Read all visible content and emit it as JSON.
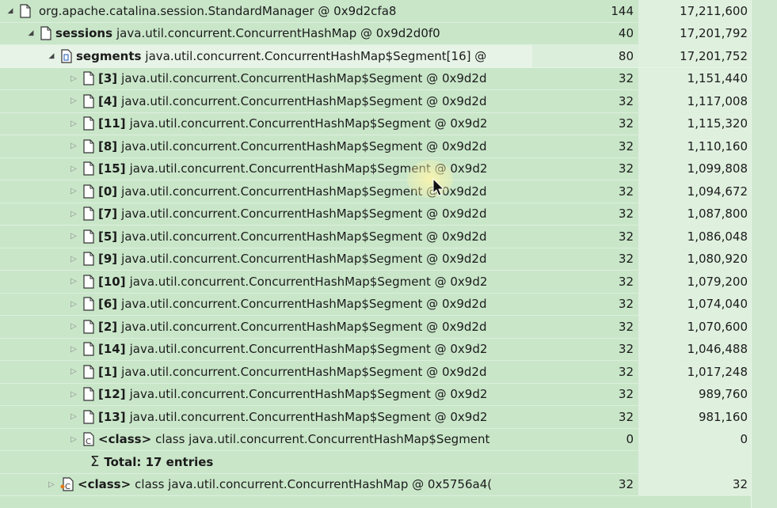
{
  "tree": {
    "rows": [
      {
        "field": "",
        "text": "org.apache.catalina.session.StandardManager @ 0x9d2cfa8",
        "shallow": "144",
        "retained": "17,211,600"
      },
      {
        "field": "sessions",
        "text": "java.util.concurrent.ConcurrentHashMap @ 0x9d2d0f0",
        "shallow": "40",
        "retained": "17,201,792"
      },
      {
        "field": "segments",
        "text": "java.util.concurrent.ConcurrentHashMap$Segment[16] @",
        "shallow": "80",
        "retained": "17,201,752"
      },
      {
        "field": "[3]",
        "text": "java.util.concurrent.ConcurrentHashMap$Segment @ 0x9d2d",
        "shallow": "32",
        "retained": "1,151,440"
      },
      {
        "field": "[4]",
        "text": "java.util.concurrent.ConcurrentHashMap$Segment @ 0x9d2d",
        "shallow": "32",
        "retained": "1,117,008"
      },
      {
        "field": "[11]",
        "text": "java.util.concurrent.ConcurrentHashMap$Segment @ 0x9d2",
        "shallow": "32",
        "retained": "1,115,320"
      },
      {
        "field": "[8]",
        "text": "java.util.concurrent.ConcurrentHashMap$Segment @ 0x9d2d",
        "shallow": "32",
        "retained": "1,110,160"
      },
      {
        "field": "[15]",
        "text": "java.util.concurrent.ConcurrentHashMap$Segment @ 0x9d2",
        "shallow": "32",
        "retained": "1,099,808"
      },
      {
        "field": "[0]",
        "text": "java.util.concurrent.ConcurrentHashMap$Segment @ 0x9d2d",
        "shallow": "32",
        "retained": "1,094,672"
      },
      {
        "field": "[7]",
        "text": "java.util.concurrent.ConcurrentHashMap$Segment @ 0x9d2d",
        "shallow": "32",
        "retained": "1,087,800"
      },
      {
        "field": "[5]",
        "text": "java.util.concurrent.ConcurrentHashMap$Segment @ 0x9d2d",
        "shallow": "32",
        "retained": "1,086,048"
      },
      {
        "field": "[9]",
        "text": "java.util.concurrent.ConcurrentHashMap$Segment @ 0x9d2d",
        "shallow": "32",
        "retained": "1,080,920"
      },
      {
        "field": "[10]",
        "text": "java.util.concurrent.ConcurrentHashMap$Segment @ 0x9d2",
        "shallow": "32",
        "retained": "1,079,200"
      },
      {
        "field": "[6]",
        "text": "java.util.concurrent.ConcurrentHashMap$Segment @ 0x9d2d",
        "shallow": "32",
        "retained": "1,074,040"
      },
      {
        "field": "[2]",
        "text": "java.util.concurrent.ConcurrentHashMap$Segment @ 0x9d2d",
        "shallow": "32",
        "retained": "1,070,600"
      },
      {
        "field": "[14]",
        "text": "java.util.concurrent.ConcurrentHashMap$Segment @ 0x9d2",
        "shallow": "32",
        "retained": "1,046,488"
      },
      {
        "field": "[1]",
        "text": "java.util.concurrent.ConcurrentHashMap$Segment @ 0x9d2d",
        "shallow": "32",
        "retained": "1,017,248"
      },
      {
        "field": "[12]",
        "text": "java.util.concurrent.ConcurrentHashMap$Segment @ 0x9d2",
        "shallow": "32",
        "retained": "989,760"
      },
      {
        "field": "[13]",
        "text": "java.util.concurrent.ConcurrentHashMap$Segment @ 0x9d2",
        "shallow": "32",
        "retained": "981,160"
      },
      {
        "field": "<class>",
        "text": "class java.util.concurrent.ConcurrentHashMap$Segment",
        "shallow": "0",
        "retained": "0"
      },
      {
        "total": "Total: 17 entries"
      },
      {
        "field": "<class>",
        "text": "class java.util.concurrent.ConcurrentHashMap @ 0x5756a4(",
        "shallow": "32",
        "retained": "32"
      }
    ]
  },
  "icons": {
    "object": "object-icon",
    "array": "array-icon",
    "class": "class-icon",
    "sum": "sum-icon",
    "expanded": "expanded-arrow-icon",
    "collapsed": "collapsed-arrow-icon"
  },
  "colors": {
    "background": "#c9e6c9",
    "retained_column": "#dff0df",
    "selected_row": "#dbeedb"
  }
}
